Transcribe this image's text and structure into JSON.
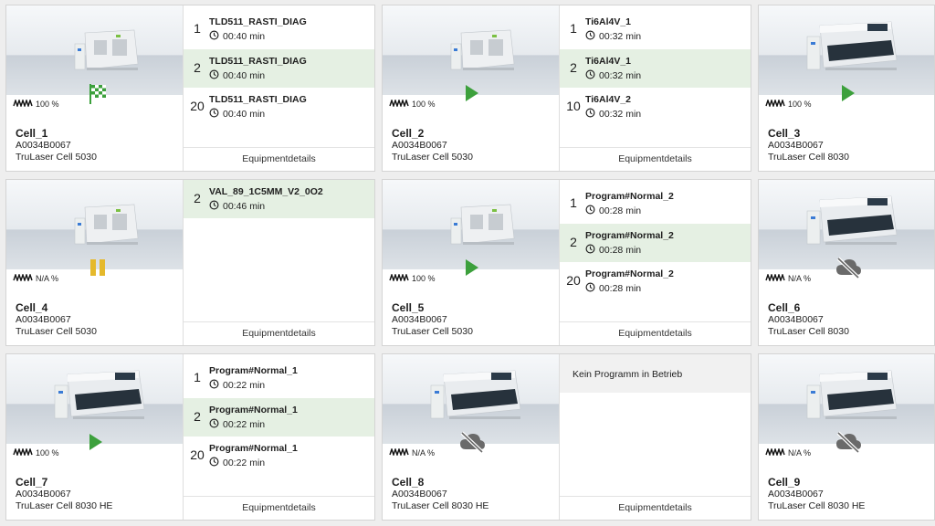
{
  "details_label": "Equipmentdetails",
  "colors": {
    "highlight": "#e5f0e3",
    "green": "#3ca03c",
    "yellow": "#e5b92c",
    "gray": "#6a6a6a"
  },
  "cells": [
    {
      "name": "Cell_1",
      "id": "A0034B0067",
      "model": "TruLaser Cell 5030",
      "utilization": "100 %",
      "status": "finished-flag-icon",
      "jobs": [
        {
          "qty": "1",
          "name": "TLD511_RASTI_DIAG",
          "time": "00:40 min"
        },
        {
          "qty": "2",
          "name": "TLD511_RASTI_DIAG",
          "time": "00:40 min"
        },
        {
          "qty": "20",
          "name": "TLD511_RASTI_DIAG",
          "time": "00:40 min"
        }
      ]
    },
    {
      "name": "Cell_2",
      "id": "A0034B0067",
      "model": "TruLaser Cell 5030",
      "utilization": "100 %",
      "status": "play-icon",
      "jobs": [
        {
          "qty": "1",
          "name": "Ti6Al4V_1",
          "time": "00:32 min"
        },
        {
          "qty": "2",
          "name": "Ti6Al4V_1",
          "time": "00:32 min"
        },
        {
          "qty": "10",
          "name": "Ti6Al4V_2",
          "time": "00:32 min"
        }
      ]
    },
    {
      "name": "Cell_3",
      "id": "A0034B0067",
      "model": "TruLaser Cell 8030",
      "utilization": "100 %",
      "status": "play-icon",
      "jobs": []
    },
    {
      "name": "Cell_4",
      "id": "A0034B0067",
      "model": "TruLaser Cell 5030",
      "utilization": "N/A %",
      "status": "pause-icon",
      "jobs": [
        {
          "qty": "2",
          "name": "VAL_89_1C5MM_V2_0O2",
          "time": "00:46 min"
        }
      ]
    },
    {
      "name": "Cell_5",
      "id": "A0034B0067",
      "model": "TruLaser Cell 5030",
      "utilization": "100 %",
      "status": "play-icon",
      "jobs": [
        {
          "qty": "1",
          "name": "Program#Normal_2",
          "time": "00:28 min"
        },
        {
          "qty": "2",
          "name": "Program#Normal_2",
          "time": "00:28 min"
        },
        {
          "qty": "20",
          "name": "Program#Normal_2",
          "time": "00:28 min"
        }
      ]
    },
    {
      "name": "Cell_6",
      "id": "A0034B0067",
      "model": "TruLaser Cell 8030",
      "utilization": "N/A %",
      "status": "cloud-offline-icon",
      "jobs": []
    },
    {
      "name": "Cell_7",
      "id": "A0034B0067",
      "model": "TruLaser Cell 8030 HE",
      "utilization": "100 %",
      "status": "play-icon",
      "jobs": [
        {
          "qty": "1",
          "name": "Program#Normal_1",
          "time": "00:22 min"
        },
        {
          "qty": "2",
          "name": "Program#Normal_1",
          "time": "00:22 min"
        },
        {
          "qty": "20",
          "name": "Program#Normal_1",
          "time": "00:22 min"
        }
      ]
    },
    {
      "name": "Cell_8",
      "id": "A0034B0067",
      "model": "TruLaser Cell 8030 HE",
      "utilization": "N/A %",
      "status": "cloud-offline-icon",
      "no_program": "Kein Programm in Betrieb",
      "jobs": []
    },
    {
      "name": "Cell_9",
      "id": "A0034B0067",
      "model": "TruLaser Cell 8030 HE",
      "utilization": "N/A %",
      "status": "cloud-offline-icon",
      "jobs": []
    }
  ]
}
